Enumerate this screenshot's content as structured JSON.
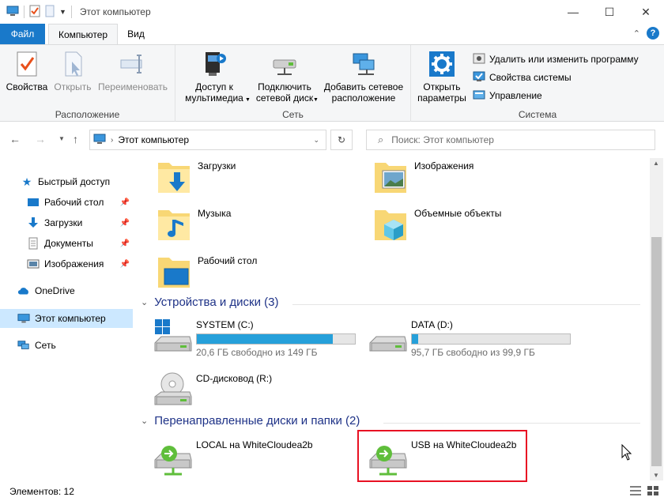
{
  "window": {
    "title": "Этот компьютер",
    "minimize": "—",
    "maximize": "☐",
    "close": "✕"
  },
  "tabs": [
    {
      "label": "Файл"
    },
    {
      "label": "Компьютер"
    },
    {
      "label": "Вид"
    }
  ],
  "ribbon": {
    "location": {
      "label": "Расположение",
      "properties": "Свойства",
      "open": "Открыть",
      "rename": "Переименовать"
    },
    "network": {
      "label": "Сеть",
      "media_line1": "Доступ к",
      "media_line2": "мультимедиа",
      "map_line1": "Подключить",
      "map_line2": "сетевой диск",
      "add_line1": "Добавить сетевое",
      "add_line2": "расположение"
    },
    "system": {
      "label": "Система",
      "settings_line1": "Открыть",
      "settings_line2": "параметры",
      "uninstall": "Удалить или изменить программу",
      "sysprops": "Свойства системы",
      "manage": "Управление"
    }
  },
  "address": {
    "path": "Этот компьютер",
    "search_placeholder": "Поиск: Этот компьютер"
  },
  "sidebar": {
    "items": [
      {
        "label": "Быстрый доступ"
      },
      {
        "label": "Рабочий стол"
      },
      {
        "label": "Загрузки"
      },
      {
        "label": "Документы"
      },
      {
        "label": "Изображения"
      },
      {
        "label": "OneDrive"
      },
      {
        "label": "Этот компьютер"
      },
      {
        "label": "Сеть"
      }
    ]
  },
  "folders": [
    {
      "name": "Загрузки"
    },
    {
      "name": "Изображения"
    },
    {
      "name": "Музыка"
    },
    {
      "name": "Объемные объекты"
    },
    {
      "name": "Рабочий стол"
    }
  ],
  "devices": {
    "header": "Устройства и диски (3)",
    "drives": [
      {
        "name": "SYSTEM (C:)",
        "free": "20,6 ГБ свободно из 149 ГБ",
        "used_fraction": 0.862
      },
      {
        "name": "DATA (D:)",
        "free": "95,7 ГБ свободно из 99,9 ГБ",
        "used_fraction": 0.042
      },
      {
        "name": "CD-дисковод (R:)"
      }
    ]
  },
  "redirected": {
    "header": "Перенаправленные диски и папки (2)",
    "items": [
      {
        "name": "LOCAL на WhiteCloudea2b"
      },
      {
        "name": "USB на WhiteCloudea2b"
      }
    ]
  },
  "status": {
    "items_count": "Элементов: 12"
  },
  "colors": {
    "accent": "#1979ca",
    "drive_bar": "#26a0da",
    "highlight": "#e81123",
    "section_header": "#1e3287"
  }
}
